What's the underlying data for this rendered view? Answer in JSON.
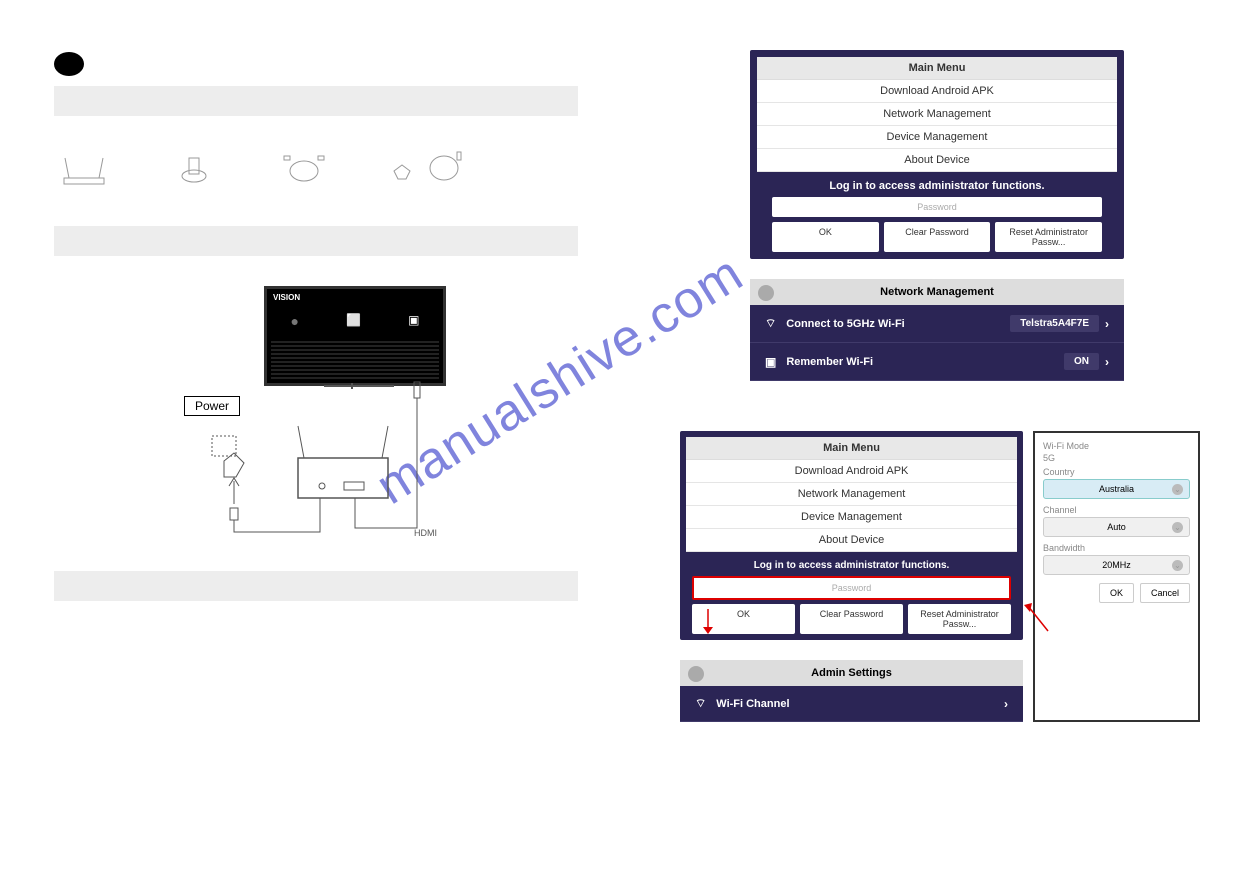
{
  "watermark": "manualshive.com",
  "left": {
    "tv_brand": "VISION",
    "power_label": "Power",
    "hdmi_label": "HDMI"
  },
  "panel1": {
    "header": "Main Menu",
    "items": [
      "Download Android APK",
      "Network Management",
      "Device Management",
      "About Device"
    ],
    "login_msg": "Log in to access administrator functions.",
    "password_placeholder": "Password",
    "buttons": [
      "OK",
      "Clear Password",
      "Reset Administrator Passw..."
    ]
  },
  "panel2": {
    "header": "Network Management",
    "row1_label": "Connect to 5GHz Wi-Fi",
    "row1_value": "Telstra5A4F7E",
    "row2_label": "Remember Wi-Fi",
    "row2_value": "ON"
  },
  "panel3": {
    "header": "Main Menu",
    "items": [
      "Download Android APK",
      "Network Management",
      "Device Management",
      "About Device"
    ],
    "login_msg": "Log in to access administrator functions.",
    "password_placeholder": "Password",
    "buttons": [
      "OK",
      "Clear Password",
      "Reset Administrator Passw..."
    ]
  },
  "wifi_popup": {
    "mode_label": "Wi-Fi Mode",
    "mode_value": "5G",
    "country_label": "Country",
    "country_value": "Australia",
    "channel_label": "Channel",
    "channel_value": "Auto",
    "bandwidth_label": "Bandwidth",
    "bandwidth_value": "20MHz",
    "ok": "OK",
    "cancel": "Cancel"
  },
  "admin_panel": {
    "header": "Admin Settings",
    "row_label": "Wi-Fi Channel"
  }
}
